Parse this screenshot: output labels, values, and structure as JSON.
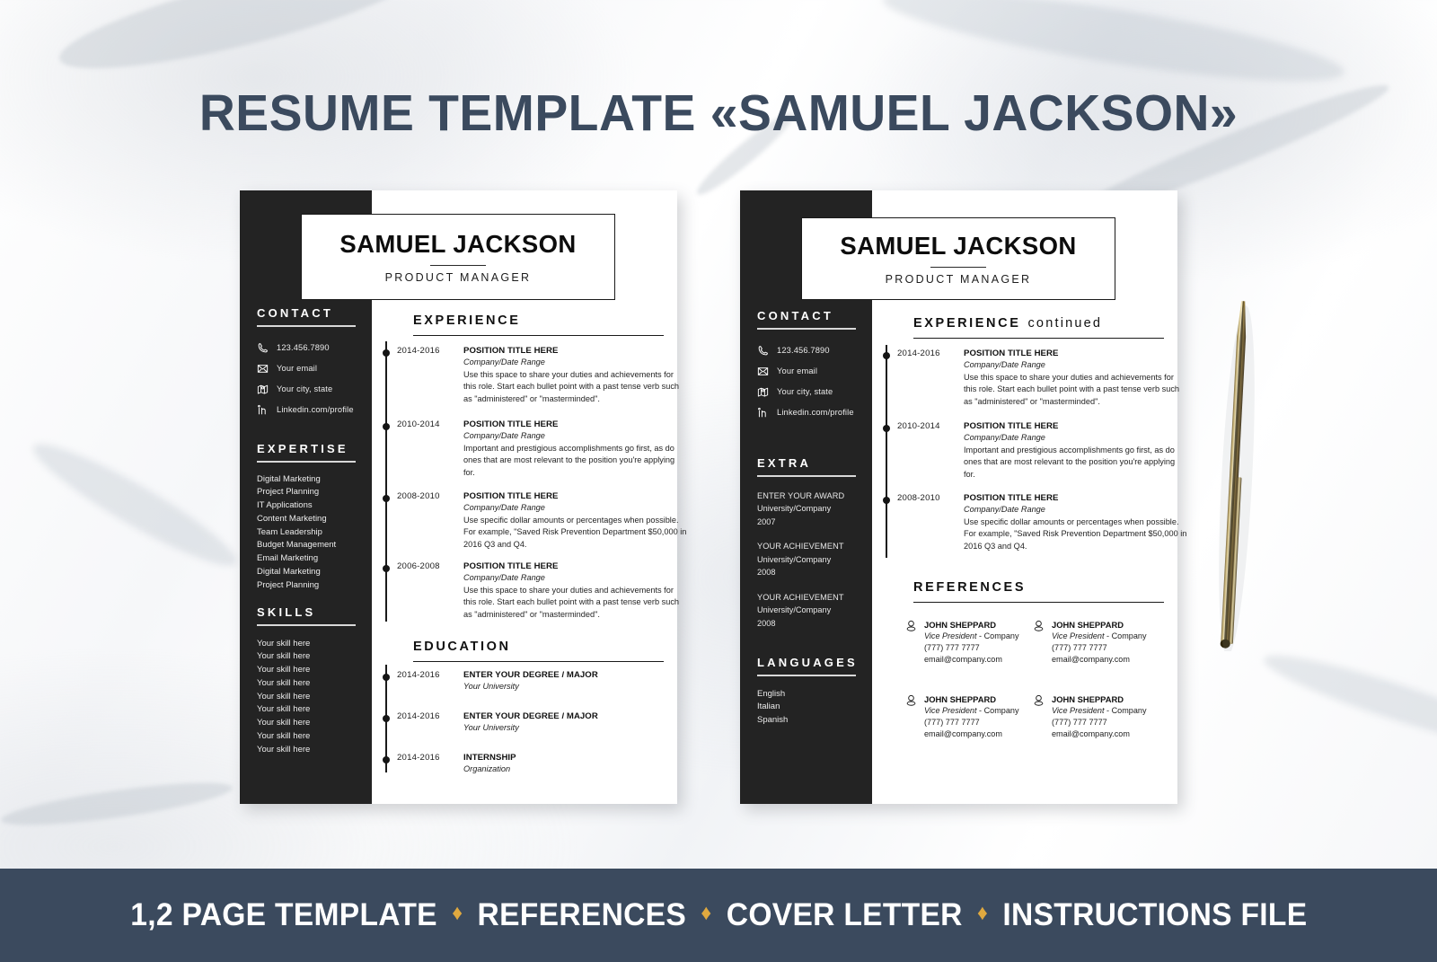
{
  "header": {
    "title": "RESUME TEMPLATE «SAMUEL JACKSON»"
  },
  "banner": {
    "items": [
      "1,2 PAGE TEMPLATE",
      "REFERENCES",
      "COVER LETTER",
      "INSTRUCTIONS FILE"
    ],
    "separator": "♦",
    "background_color": "#3b4a5e",
    "separator_color": "#e0a93f"
  },
  "colors": {
    "sidebar": "#232323",
    "page": "#ffffff",
    "title": "#3b4a5e",
    "accent": "#e0a93f"
  },
  "resume": {
    "name": "SAMUEL JACKSON",
    "role": "PRODUCT MANAGER"
  },
  "page1": {
    "sidebar": {
      "contact": {
        "heading": "CONTACT",
        "rows": [
          {
            "icon": "phone-icon",
            "text": "123.456.7890"
          },
          {
            "icon": "envelope-icon",
            "text": "Your email"
          },
          {
            "icon": "map-icon",
            "text": "Your city, state"
          },
          {
            "icon": "linkedin-icon",
            "text": "Linkedin.com/profile"
          }
        ]
      },
      "expertise": {
        "heading": "EXPERTISE",
        "items": [
          "Digital Marketing",
          "Project Planning",
          "IT Applications",
          "Content Marketing",
          "Team Leadership",
          "Budget Management",
          "Email Marketing",
          "Digital Marketing",
          "Project Planning"
        ]
      },
      "skills": {
        "heading": "SKILLS",
        "items": [
          "Your skill here",
          "Your skill here",
          "Your skill here",
          "Your skill here",
          "Your skill here",
          "Your skill here",
          "Your skill here",
          "Your skill here",
          "Your skill here"
        ]
      }
    },
    "experience": {
      "heading": "EXPERIENCE",
      "entries": [
        {
          "years": "2014-2016",
          "position": "POSITION TITLE HERE",
          "company": "Company/Date Range",
          "description": "Use this space to share your duties and achievements for this role. Start each bullet point with a past tense verb such as \"administered\" or \"masterminded\"."
        },
        {
          "years": "2010-2014",
          "position": "POSITION TITLE HERE",
          "company": "Company/Date Range",
          "description": "Important and prestigious accomplishments go first, as do ones that are most relevant to the position you're applying for."
        },
        {
          "years": "2008-2010",
          "position": "POSITION TITLE HERE",
          "company": "Company/Date Range",
          "description": "Use specific dollar amounts or percentages when possible. For example, \"Saved Risk Prevention Department $50,000 in 2016 Q3 and Q4."
        },
        {
          "years": "2006-2008",
          "position": "POSITION TITLE HERE",
          "company": "Company/Date Range",
          "description": "Use this space to share your duties and achievements for this role. Start each bullet point with a past tense verb such as \"administered\" or \"masterminded\"."
        }
      ]
    },
    "education": {
      "heading": "EDUCATION",
      "entries": [
        {
          "years": "2014-2016",
          "position": "ENTER YOUR DEGREE / MAJOR",
          "company": "Your University"
        },
        {
          "years": "2014-2016",
          "position": "ENTER YOUR DEGREE / MAJOR",
          "company": "Your University"
        },
        {
          "years": "2014-2016",
          "position": "INTERNSHIP",
          "company": "Organization"
        }
      ]
    }
  },
  "page2": {
    "sidebar": {
      "contact": {
        "heading": "CONTACT",
        "rows": [
          {
            "icon": "phone-icon",
            "text": "123.456.7890"
          },
          {
            "icon": "envelope-icon",
            "text": "Your email"
          },
          {
            "icon": "map-icon",
            "text": "Your city, state"
          },
          {
            "icon": "linkedin-icon",
            "text": "Linkedin.com/profile"
          }
        ]
      },
      "extra": {
        "heading": "EXTRA",
        "entries": [
          {
            "title": "ENTER YOUR AWARD",
            "org": "University/Company",
            "year": "2007"
          },
          {
            "title": "YOUR ACHIEVEMENT",
            "org": "University/Company",
            "year": "2008"
          },
          {
            "title": "YOUR ACHIEVEMENT",
            "org": "University/Company",
            "year": "2008"
          }
        ]
      },
      "languages": {
        "heading": "LANGUAGES",
        "items": [
          "English",
          "Italian",
          "Spanish"
        ]
      }
    },
    "experience": {
      "heading": "EXPERIENCE",
      "heading_suffix": "continued",
      "entries": [
        {
          "years": "2014-2016",
          "position": "POSITION TITLE HERE",
          "company": "Company/Date Range",
          "description": "Use this space to share your duties and achievements for this role. Start each bullet point with a past tense verb such as \"administered\" or \"masterminded\"."
        },
        {
          "years": "2010-2014",
          "position": "POSITION TITLE HERE",
          "company": "Company/Date Range",
          "description": "Important and prestigious accomplishments go first, as do ones that are most relevant to the position you're applying for."
        },
        {
          "years": "2008-2010",
          "position": "POSITION TITLE HERE",
          "company": "Company/Date Range",
          "description": "Use specific dollar amounts or percentages when possible. For example, \"Saved Risk Prevention Department $50,000 in 2016 Q3 and Q4."
        }
      ]
    },
    "references": {
      "heading": "REFERENCES",
      "entries": [
        {
          "name": "JOHN SHEPPARD",
          "title_italic": "Vice President",
          "title_rest": " - Company",
          "phone": "(777) 777 7777",
          "email": "email@company.com"
        },
        {
          "name": "JOHN SHEPPARD",
          "title_italic": "Vice President",
          "title_rest": " - Company",
          "phone": "(777) 777 7777",
          "email": "email@company.com"
        },
        {
          "name": "JOHN SHEPPARD",
          "title_italic": "Vice President",
          "title_rest": " - Company",
          "phone": "(777) 777 7777",
          "email": "email@company.com"
        },
        {
          "name": "JOHN SHEPPARD",
          "title_italic": "Vice President",
          "title_rest": " - Company",
          "phone": "(777) 777 7777",
          "email": "email@company.com"
        }
      ]
    }
  }
}
